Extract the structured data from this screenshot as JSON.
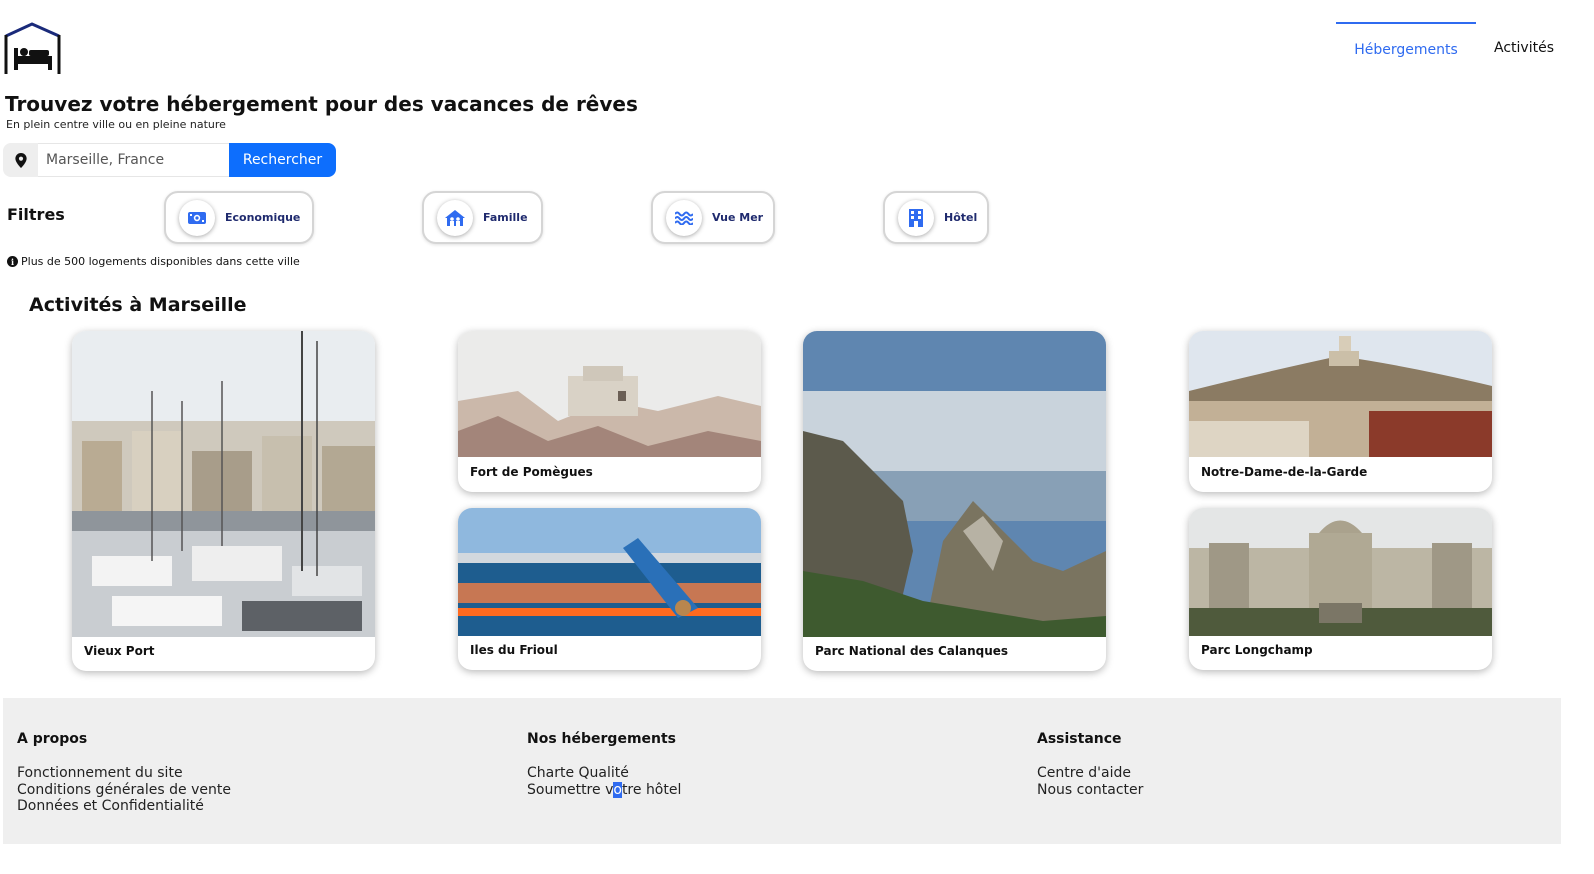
{
  "header": {
    "logo_icon": "hotel-bed-icon",
    "nav": [
      {
        "label": "Hébergements",
        "active": true
      },
      {
        "label": "Activités",
        "active": false
      }
    ]
  },
  "hero": {
    "title": "Trouvez votre hébergement pour des vacances de rêves",
    "subtitle": "En plein centre ville ou en pleine nature"
  },
  "search": {
    "icon": "location-pin-icon",
    "placeholder": "Marseille, France",
    "button_label": "Rechercher"
  },
  "filters": {
    "label": "Filtres",
    "items": [
      {
        "label": "Economique",
        "icon": "money-icon"
      },
      {
        "label": "Famille",
        "icon": "family-home-icon"
      },
      {
        "label": "Vue Mer",
        "icon": "waves-icon"
      },
      {
        "label": "Hôtel",
        "icon": "hotel-building-icon"
      }
    ]
  },
  "info": {
    "icon": "info-icon",
    "text": "Plus de 500 logements disponibles dans cette ville"
  },
  "activities": {
    "title": "Activités à Marseille",
    "cards": [
      {
        "label": "Vieux Port"
      },
      {
        "label": "Fort de Pomègues"
      },
      {
        "label": "Iles du Frioul"
      },
      {
        "label": "Parc National des Calanques"
      },
      {
        "label": "Notre-Dame-de-la-Garde"
      },
      {
        "label": "Parc Longchamp"
      }
    ]
  },
  "footer": {
    "columns": [
      {
        "heading": "A propos",
        "links": [
          "Fonctionnement du site",
          "Conditions générales de vente",
          "Données et Confidentialité"
        ]
      },
      {
        "heading": "Nos hébergements",
        "links": [
          "Charte Qualité",
          "Soumettre votre hôtel"
        ]
      },
      {
        "heading": "Assistance",
        "links": [
          "Centre d'aide",
          "Nous contacter"
        ]
      }
    ],
    "selection": {
      "before": "Soumettre v",
      "selected": "o",
      "after": "tre hôtel"
    }
  },
  "colors": {
    "accent": "#0d6efd",
    "nav_active": "#2f6bf0",
    "footer_bg": "#efefef",
    "filter_text": "#1f2a6e"
  }
}
